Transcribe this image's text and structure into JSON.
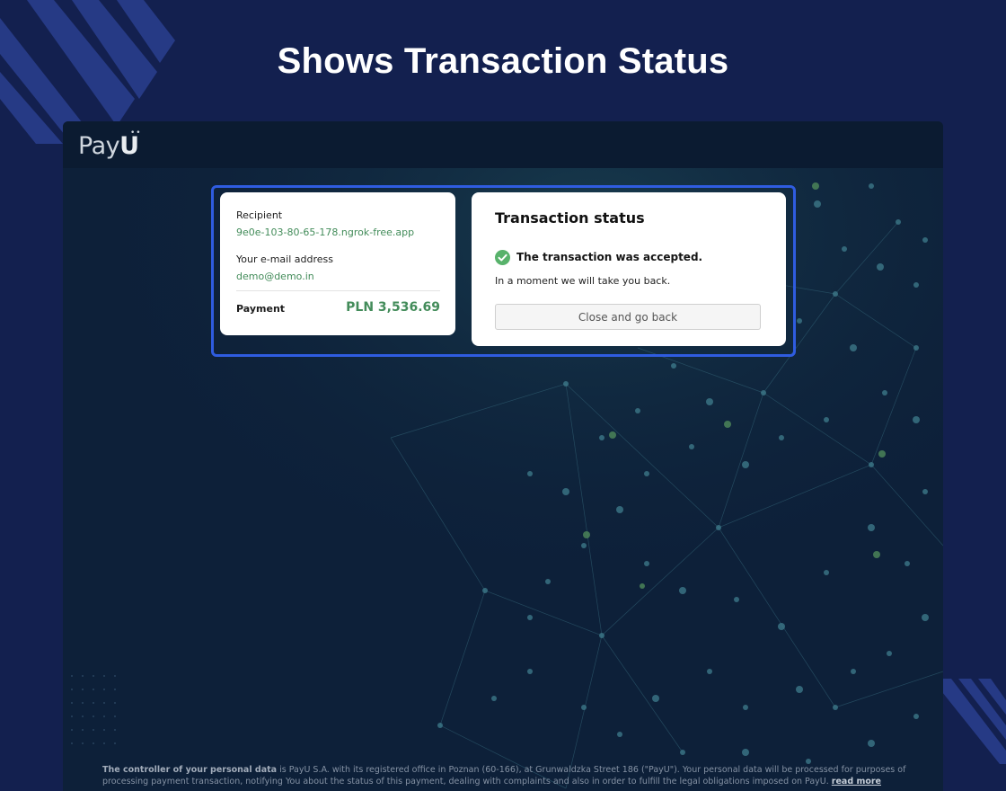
{
  "page": {
    "heading": "Shows Transaction Status"
  },
  "app": {
    "logo_text": "Pay",
    "logo_u": "U"
  },
  "summary": {
    "recipient_label": "Recipient",
    "recipient_value": "9e0e-103-80-65-178.ngrok-free.app",
    "email_label": "Your e-mail address",
    "email_value": "demo@demo.in",
    "payment_label": "Payment",
    "payment_amount": "PLN 3,536.69"
  },
  "status": {
    "title": "Transaction status",
    "icon": "check-circle-icon",
    "message": "The transaction was accepted.",
    "submessage": "In a moment we will take you back.",
    "button_label": "Close and go back"
  },
  "footer": {
    "bold_lead": "The controller of your personal data",
    "text": " is PayU S.A. with its registered office in Poznan (60-166), at Grunwaldzka Street 186 (\"PayU\"). Your personal data will be processed for purposes of processing payment transaction, notifying You about the status of this payment, dealing with complaints and also in order to fulfill the legal obligations imposed on PayU. ",
    "read_more": "read more"
  },
  "colors": {
    "page_background": "#13204f",
    "accent_green": "#438c5a",
    "highlight_border": "#2f5ce0",
    "check_green": "#58b26b"
  }
}
